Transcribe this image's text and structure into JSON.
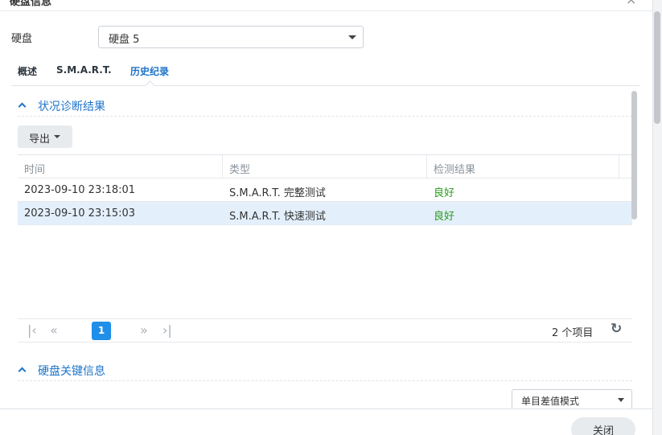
{
  "dialog": {
    "title": "硬盘信息",
    "close_icon": "close-icon"
  },
  "disk": {
    "label": "硬盘",
    "selected": "硬盘 5"
  },
  "tabs": [
    {
      "label": "概述",
      "active": false
    },
    {
      "label": "S.M.A.R.T.",
      "active": false
    },
    {
      "label": "历史纪录",
      "active": true
    }
  ],
  "section_diagnosis": {
    "title": "状况诊断结果",
    "export_label": "导出",
    "columns": [
      "时间",
      "类型",
      "检测结果"
    ],
    "rows": [
      {
        "time": "2023-09-10 23:18:01",
        "type": "S.M.A.R.T. 完整测试",
        "result": "良好",
        "selected": false
      },
      {
        "time": "2023-09-10 23:15:03",
        "type": "S.M.A.R.T. 快速测试",
        "result": "良好",
        "selected": true
      }
    ],
    "pagination": {
      "current_page": "1",
      "total_items": "2 个项目"
    }
  },
  "section_key_info": {
    "title": "硬盘关键信息",
    "mode_select": "单目差值模式"
  },
  "footer": {
    "close_label": "关闭"
  },
  "colors": {
    "accent": "#1f74c9",
    "good": "#2b9a1d",
    "selected_row": "#e3effb",
    "page_active": "#1f8fe8"
  }
}
